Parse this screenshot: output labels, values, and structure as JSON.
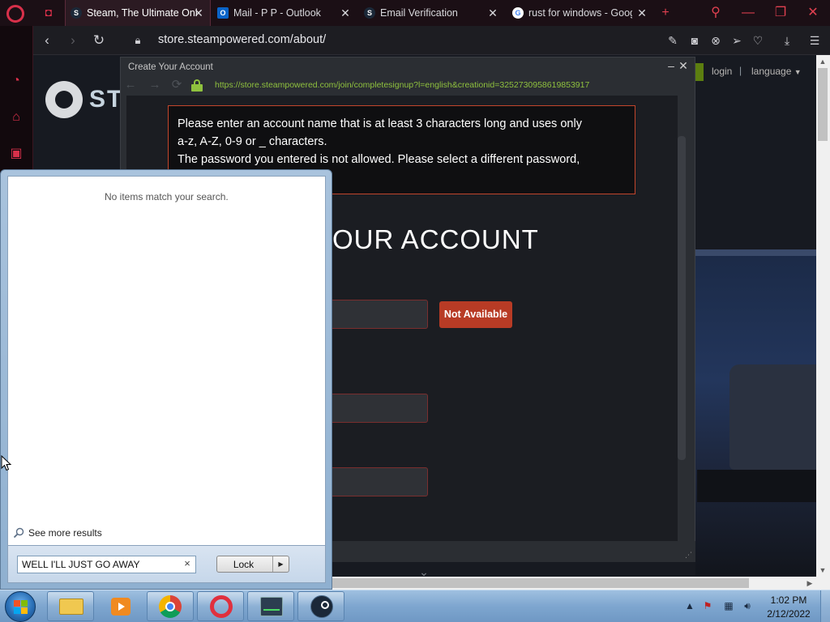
{
  "browser": {
    "tabs": [
      {
        "title": "Steam, The Ultimate Onl",
        "favicon": "steam-icon",
        "active": true
      },
      {
        "title": "Mail - P P - Outlook",
        "favicon": "outlook-icon",
        "active": false
      },
      {
        "title": "Email Verification",
        "favicon": "steam-icon",
        "active": false
      },
      {
        "title": "rust for windows - Goog",
        "favicon": "google-icon",
        "active": false
      }
    ],
    "address": "store.steampowered.com/about/",
    "accent": "#d8304a"
  },
  "steam": {
    "logo_text": "STE",
    "login": "login",
    "separator": "|",
    "language": "language"
  },
  "popup": {
    "title": "Create Your Account",
    "url": "https://store.steampowered.com/join/completesignup?l=english&creationid=3252730958619853917",
    "error_lines": [
      "Please enter an account name that is at least 3 characters long and uses only",
      "a-z, A-Z, 0-9 or _ characters.",
      "The password you entered is not allowed. Please select a different password,"
    ],
    "heading": "OUR ACCOUNT",
    "availability": "Not Available",
    "error_color": "#c2452c"
  },
  "start_menu": {
    "no_results": "No items match your search.",
    "see_more": "See more results",
    "search_value": "WELL I'LL JUST GO AWAY",
    "lock_label": "Lock"
  },
  "taskbar": {
    "apps": [
      "file-explorer-icon",
      "media-player-icon",
      "chrome-icon",
      "opera-icon",
      "task-manager-icon",
      "steam-icon"
    ],
    "time": "1:02 PM",
    "date": "2/12/2022"
  }
}
